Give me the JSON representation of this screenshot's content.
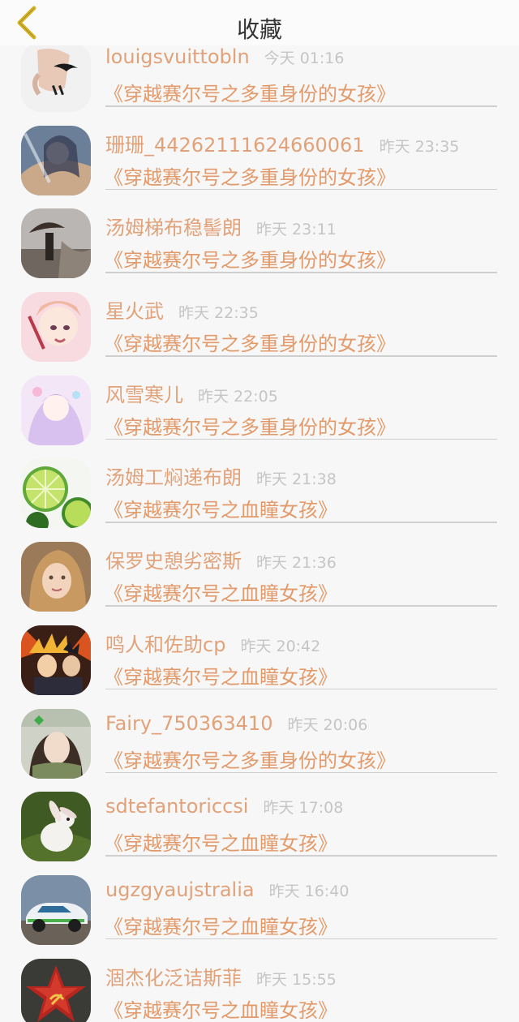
{
  "header": {
    "title": "收藏",
    "back_icon": "chevron-left-icon",
    "accent": "#d9b52a"
  },
  "colors": {
    "name": "#e1a27a",
    "book": "#e39a6a",
    "time": "#c5c5c5",
    "divider": "#cfcfcf"
  },
  "items": [
    {
      "name": "louigsvuittobln",
      "time": "今天 01:16",
      "book": "《穿越赛尔号之多重身份的女孩》",
      "avatar": "avatar-mustache-hand"
    },
    {
      "name": "珊珊_44262111624660061",
      "time": "昨天 23:35",
      "book": "《穿越赛尔号之多重身份的女孩》",
      "avatar": "avatar-anime-girl"
    },
    {
      "name": "汤姆梯布稳髻朗",
      "time": "昨天 23:11",
      "book": "《穿越赛尔号之多重身份的女孩》",
      "avatar": "avatar-umbrella-girl"
    },
    {
      "name": "星火武",
      "time": "昨天 22:35",
      "book": "《穿越赛尔号之多重身份的女孩》",
      "avatar": "avatar-anime-crying"
    },
    {
      "name": "风雪寒儿",
      "time": "昨天 22:05",
      "book": "《穿越赛尔号之多重身份的女孩》",
      "avatar": "avatar-anime-pastel"
    },
    {
      "name": "汤姆工焖递布朗",
      "time": "昨天 21:38",
      "book": "《穿越赛尔号之血瞳女孩》",
      "avatar": "avatar-limes"
    },
    {
      "name": "保罗史憩劣密斯",
      "time": "昨天 21:36",
      "book": "《穿越赛尔号之血瞳女孩》",
      "avatar": "avatar-child-photo"
    },
    {
      "name": "鸣人和佐助cp",
      "time": "昨天 20:42",
      "book": "《穿越赛尔号之血瞳女孩》",
      "avatar": "avatar-naruto"
    },
    {
      "name": "Fairy_750363410",
      "time": "昨天 20:06",
      "book": "《穿越赛尔号之多重身份的女孩》",
      "avatar": "avatar-green-girl"
    },
    {
      "name": "sdtefantoriccsi",
      "time": "昨天 17:08",
      "book": "《穿越赛尔号之血瞳女孩》",
      "avatar": "avatar-rabbit"
    },
    {
      "name": "ugzgyaujstralia",
      "time": "昨天 16:40",
      "book": "《穿越赛尔号之血瞳女孩》",
      "avatar": "avatar-rally-car"
    },
    {
      "name": "涸杰化泛诘斯菲",
      "time": "昨天 15:55",
      "book": "《穿越赛尔号之血瞳女孩》",
      "avatar": "avatar-red-star"
    }
  ]
}
